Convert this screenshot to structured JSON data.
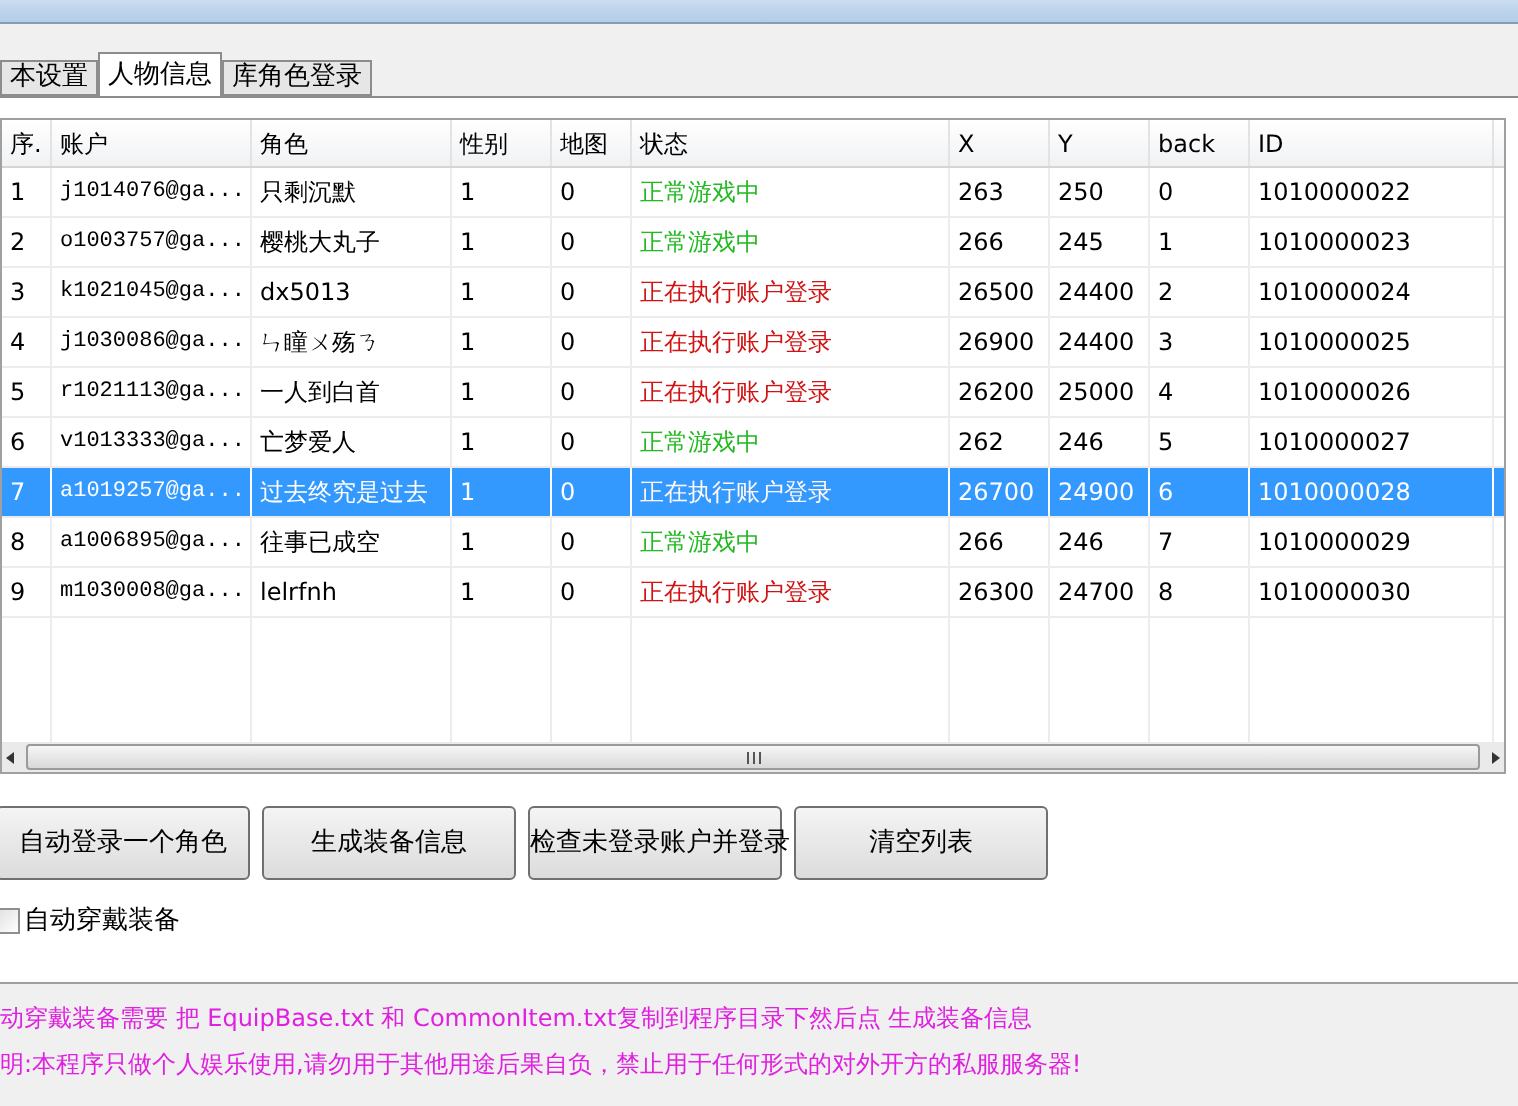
{
  "tabs": [
    {
      "label": "本设置",
      "selected": false
    },
    {
      "label": "人物信息",
      "selected": true
    },
    {
      "label": "库角色登录",
      "selected": false
    }
  ],
  "table": {
    "columns": [
      "序.",
      "账户",
      "角色",
      "性别",
      "地图",
      "状态",
      "X",
      "Y",
      "back",
      "ID"
    ],
    "rows": [
      {
        "selected": false,
        "kind": "playing",
        "cells": [
          "1",
          "j1014076@ga...",
          "只剩沉默",
          "1",
          "0",
          "正常游戏中",
          "263",
          "250",
          "0",
          "1010000022"
        ]
      },
      {
        "selected": false,
        "kind": "playing",
        "cells": [
          "2",
          "o1003757@ga...",
          "樱桃大丸子",
          "1",
          "0",
          "正常游戏中",
          "266",
          "245",
          "1",
          "1010000023"
        ]
      },
      {
        "selected": false,
        "kind": "logging",
        "cells": [
          "3",
          "k1021045@ga...",
          "dx5013",
          "1",
          "0",
          "正在执行账户登录",
          "26500",
          "24400",
          "2",
          "1010000024"
        ]
      },
      {
        "selected": false,
        "kind": "logging",
        "cells": [
          "4",
          "j1030086@ga...",
          "ㄣ瞳ㄨ殇ㄋ",
          "1",
          "0",
          "正在执行账户登录",
          "26900",
          "24400",
          "3",
          "1010000025"
        ]
      },
      {
        "selected": false,
        "kind": "logging",
        "cells": [
          "5",
          "r1021113@ga...",
          "一人到白首",
          "1",
          "0",
          "正在执行账户登录",
          "26200",
          "25000",
          "4",
          "1010000026"
        ]
      },
      {
        "selected": false,
        "kind": "playing",
        "cells": [
          "6",
          "v1013333@ga...",
          "亡梦爱人",
          "1",
          "0",
          "正常游戏中",
          "262",
          "246",
          "5",
          "1010000027"
        ]
      },
      {
        "selected": true,
        "kind": "logging",
        "cells": [
          "7",
          "a1019257@ga...",
          "过去终究是过去",
          "1",
          "0",
          "正在执行账户登录",
          "26700",
          "24900",
          "6",
          "1010000028"
        ]
      },
      {
        "selected": false,
        "kind": "playing",
        "cells": [
          "8",
          "a1006895@ga...",
          "往事已成空",
          "1",
          "0",
          "正常游戏中",
          "266",
          "246",
          "7",
          "1010000029"
        ]
      },
      {
        "selected": false,
        "kind": "logging",
        "cells": [
          "9",
          "m1030008@ga...",
          "lelrfnh",
          "1",
          "0",
          "正在执行账户登录",
          "26300",
          "24700",
          "8",
          "1010000030"
        ]
      }
    ]
  },
  "buttons": [
    "自动登录一个角色",
    "生成装备信息",
    "检查未登录账户并登录",
    "清空列表"
  ],
  "auto_equip": {
    "label": "自动穿戴装备",
    "checked": false
  },
  "notes": [
    "动穿戴装备需要 把  EquipBase.txt 和 CommonItem.txt复制到程序目录下然后点 生成装备信息",
    "明:本程序只做个人娱乐使用,请勿用于其他用途后果自负，禁止用于任何形式的对外开方的私服服务器!"
  ]
}
